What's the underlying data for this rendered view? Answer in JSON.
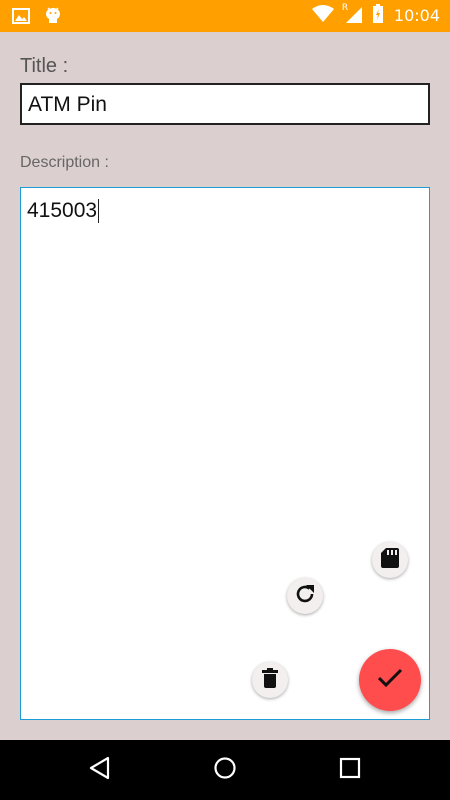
{
  "status_bar": {
    "time": "10:04",
    "left_icons": [
      "image-icon",
      "android-icon"
    ],
    "right_icons": [
      "wifi-icon",
      "signal-icon",
      "battery-icon"
    ],
    "roaming_indicator": "R"
  },
  "form": {
    "title_label": "Title :",
    "title_value": "ATM Pin",
    "description_label": "Description :",
    "description_value": "415003"
  },
  "actions": {
    "save_sd": "sd-card-icon",
    "refresh": "refresh-icon",
    "delete": "trash-icon",
    "confirm": "check-icon"
  },
  "navigation": [
    "back-icon",
    "home-icon",
    "recent-apps-icon"
  ],
  "colors": {
    "status_bar": "#ffa000",
    "background": "#dbd0cf",
    "confirm_fab": "#ff4c4c",
    "focus_border": "#1e9cd7"
  }
}
